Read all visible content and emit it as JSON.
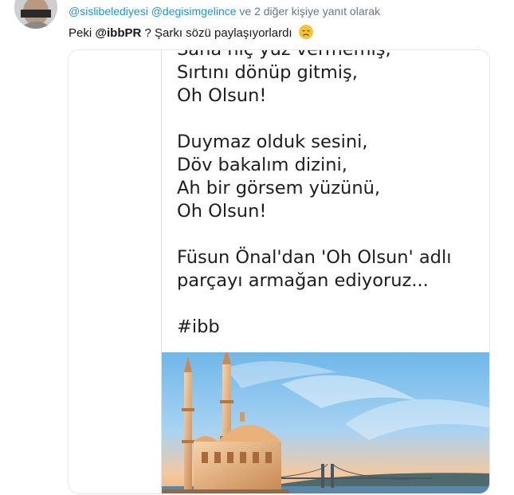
{
  "reply": {
    "mentions": [
      "@sislibelediyesi",
      "@degisimgelince"
    ],
    "suffix": "ve 2 diğer kişiye yanıt olarak"
  },
  "tweet": {
    "prefix": "Peki",
    "mention": "@ibbPR",
    "rest": "? Şarkı sözü paylaşıyorlardı",
    "emoji": "disappointed-face-emoji"
  },
  "image": {
    "lines": [
      "Sana hiç yüz vermemiş,",
      "Sırtını dönüp gitmiş,",
      "Oh Olsun!",
      "",
      "Duymaz olduk sesini,",
      "Döv bakalım dizini,",
      "Ah bir görsem yüzünü,",
      "Oh Olsun!",
      "",
      "Füsun Önal'dan 'Oh Olsun' adlı",
      "parçayı armağan ediyoruz...",
      "",
      "#ibb"
    ]
  },
  "colors": {
    "link": "#1b95e0",
    "muted": "#657786",
    "text": "#14171a",
    "card_border": "#e1e8ed"
  }
}
